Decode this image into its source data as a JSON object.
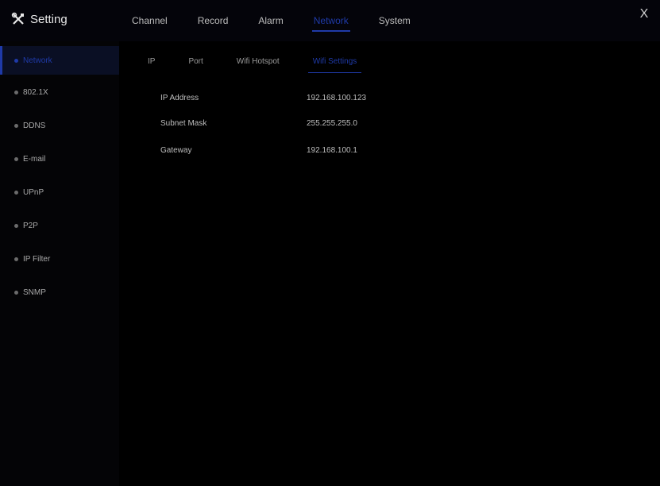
{
  "header": {
    "title": "Setting",
    "close": "X"
  },
  "tabs": [
    {
      "label": "Channel"
    },
    {
      "label": "Record"
    },
    {
      "label": "Alarm"
    },
    {
      "label": "Network",
      "active": true
    },
    {
      "label": "System"
    }
  ],
  "sidebar": {
    "items": [
      {
        "label": "Network"
      },
      {
        "label": "802.1X"
      },
      {
        "label": "DDNS"
      },
      {
        "label": "E-mail"
      },
      {
        "label": "UPnP"
      },
      {
        "label": "P2P"
      },
      {
        "label": "IP Filter"
      },
      {
        "label": "SNMP"
      }
    ]
  },
  "subtabs": [
    {
      "label": "IP"
    },
    {
      "label": "Port"
    },
    {
      "label": "Wifi Hotspot"
    },
    {
      "label": "Wifi Settings",
      "active": true
    }
  ],
  "info": {
    "rows": [
      {
        "key": "IP Address",
        "value": "192.168.100.123"
      },
      {
        "key": "Subnet Mask",
        "value": "255.255.255.0"
      },
      {
        "key": "Gateway",
        "value": "192.168.100.1"
      }
    ]
  },
  "colors": {
    "accent": "#1f3aa8",
    "background": "#000000"
  }
}
